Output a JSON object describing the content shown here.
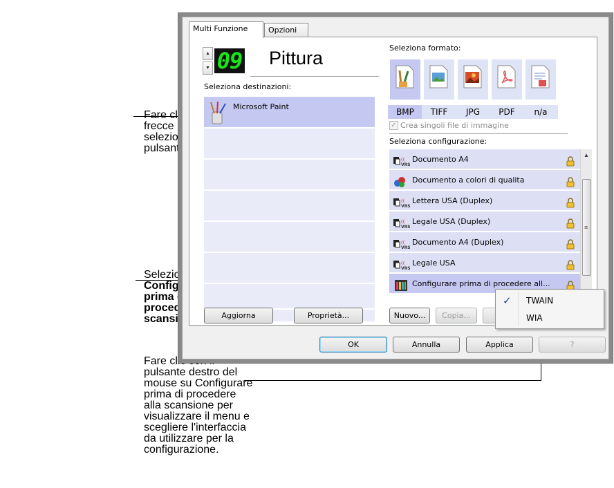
{
  "callouts": {
    "arrows": [
      "Fare clic sulle",
      "frecce per",
      "selezionare il",
      "pulsante."
    ],
    "configure_prefix": "Selezionare",
    "configure_bold": [
      "Configurare",
      "prima di",
      "procedere alla",
      "scansione"
    ],
    "configure_suffix": ".",
    "rightclick": [
      "Fare clic con il",
      "pulsante destro del",
      "mouse su Configurare",
      "prima di procedere",
      "alla scansione per",
      "visualizzare il menu e",
      "scegliere l'interfaccia",
      "da utilizzare per la",
      "configurazione."
    ]
  },
  "tabs": [
    {
      "label": "Multi Funzione",
      "active": true
    },
    {
      "label": "Opzioni",
      "active": false
    }
  ],
  "button_number": "09",
  "destination_name": "Pittura",
  "select_destinations_label": "Seleziona destinazioni:",
  "destinations": [
    {
      "label": "Microsoft Paint",
      "icon": "paint-icon",
      "selected": true
    }
  ],
  "select_format_label": "Seleziona formato:",
  "formats": [
    {
      "label": "BMP",
      "icon": "bmp-icon",
      "selected": true,
      "color": "#e8a040"
    },
    {
      "label": "TIFF",
      "icon": "tiff-icon",
      "selected": false,
      "color": "#5aa0d8"
    },
    {
      "label": "JPG",
      "icon": "jpg-icon",
      "selected": false,
      "color": "#d84a28"
    },
    {
      "label": "PDF",
      "icon": "pdf-icon",
      "selected": false,
      "color": "#e05858"
    },
    {
      "label": "n/a",
      "icon": "text-doc-icon",
      "selected": false,
      "color": "#7090c0"
    }
  ],
  "single_image_checkbox": {
    "label": "Crea singoli file di immagine",
    "checked": true,
    "enabled": false
  },
  "select_config_label": "Seleziona configurazione:",
  "configurations": [
    {
      "label": "Documento A4",
      "icon": "vrs-icon",
      "locked": true
    },
    {
      "label": "Documento a colori di qualita",
      "icon": "color-icon",
      "locked": true
    },
    {
      "label": "Lettera USA (Duplex)",
      "icon": "vrs-icon",
      "locked": true
    },
    {
      "label": "Legale USA (Duplex)",
      "icon": "vrs-icon",
      "locked": true
    },
    {
      "label": "Documento A4 (Duplex)",
      "icon": "vrs-icon",
      "locked": true
    },
    {
      "label": "Legale USA",
      "icon": "vrs-icon",
      "locked": true
    },
    {
      "label": "Configurare prima di procedere all...",
      "icon": "configure-icon",
      "locked": true,
      "selected": true
    }
  ],
  "buttons": {
    "refresh": "Aggiorna",
    "properties": "Proprietà...",
    "new": "Nuovo...",
    "copy": "Copia...",
    "ok": "OK",
    "cancel": "Annulla",
    "apply": "Applica",
    "help": "?"
  },
  "context_menu": [
    {
      "label": "TWAIN",
      "checked": true
    },
    {
      "label": "WIA",
      "checked": false
    }
  ],
  "colors": {
    "selection": "#c5c8f0",
    "row": "#dde0f5",
    "lcd_digits": "#19e619"
  }
}
